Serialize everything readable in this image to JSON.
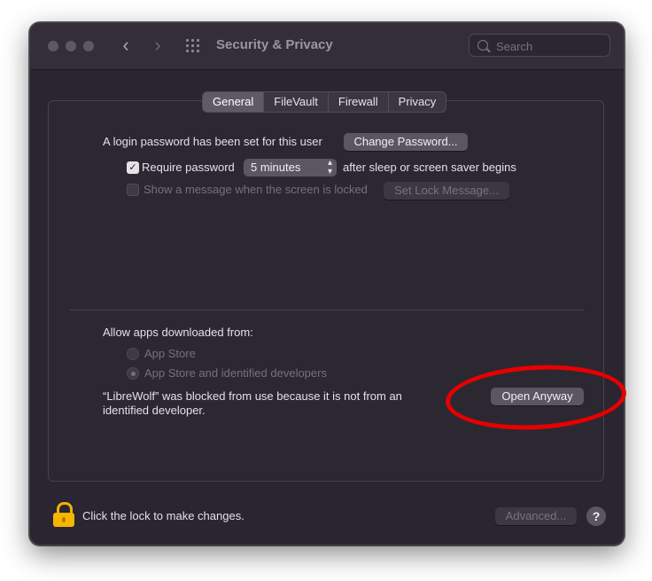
{
  "window": {
    "title": "Security & Privacy"
  },
  "search": {
    "placeholder": "Search"
  },
  "tabs": [
    {
      "label": "General",
      "active": true
    },
    {
      "label": "FileVault",
      "active": false
    },
    {
      "label": "Firewall",
      "active": false
    },
    {
      "label": "Privacy",
      "active": false
    }
  ],
  "general": {
    "login_text": "A login password has been set for this user",
    "change_password_label": "Change Password...",
    "require_password_label": "Require password",
    "require_password_checked": true,
    "require_password_value": "5 minutes",
    "after_sleep_text": "after sleep or screen saver begins",
    "show_message_label": "Show a message when the screen is locked",
    "show_message_checked": false,
    "set_lock_message_label": "Set Lock Message...",
    "allow_apps_label": "Allow apps downloaded from:",
    "radio_app_store": "App Store",
    "radio_identified": "App Store and identified developers",
    "selected_radio": "App Store and identified developers",
    "blocked_line1": "“LibreWolf” was blocked from use because it is not from an",
    "blocked_line2": "identified developer.",
    "open_anyway_label": "Open Anyway"
  },
  "footer": {
    "lock_text": "Click the lock to make changes.",
    "advanced_label": "Advanced...",
    "help_label": "?"
  },
  "colors": {
    "window_bg": "#2a2530",
    "button_bg": "#5b5762",
    "lock": "#f6b600",
    "annotation": "#e70000"
  }
}
